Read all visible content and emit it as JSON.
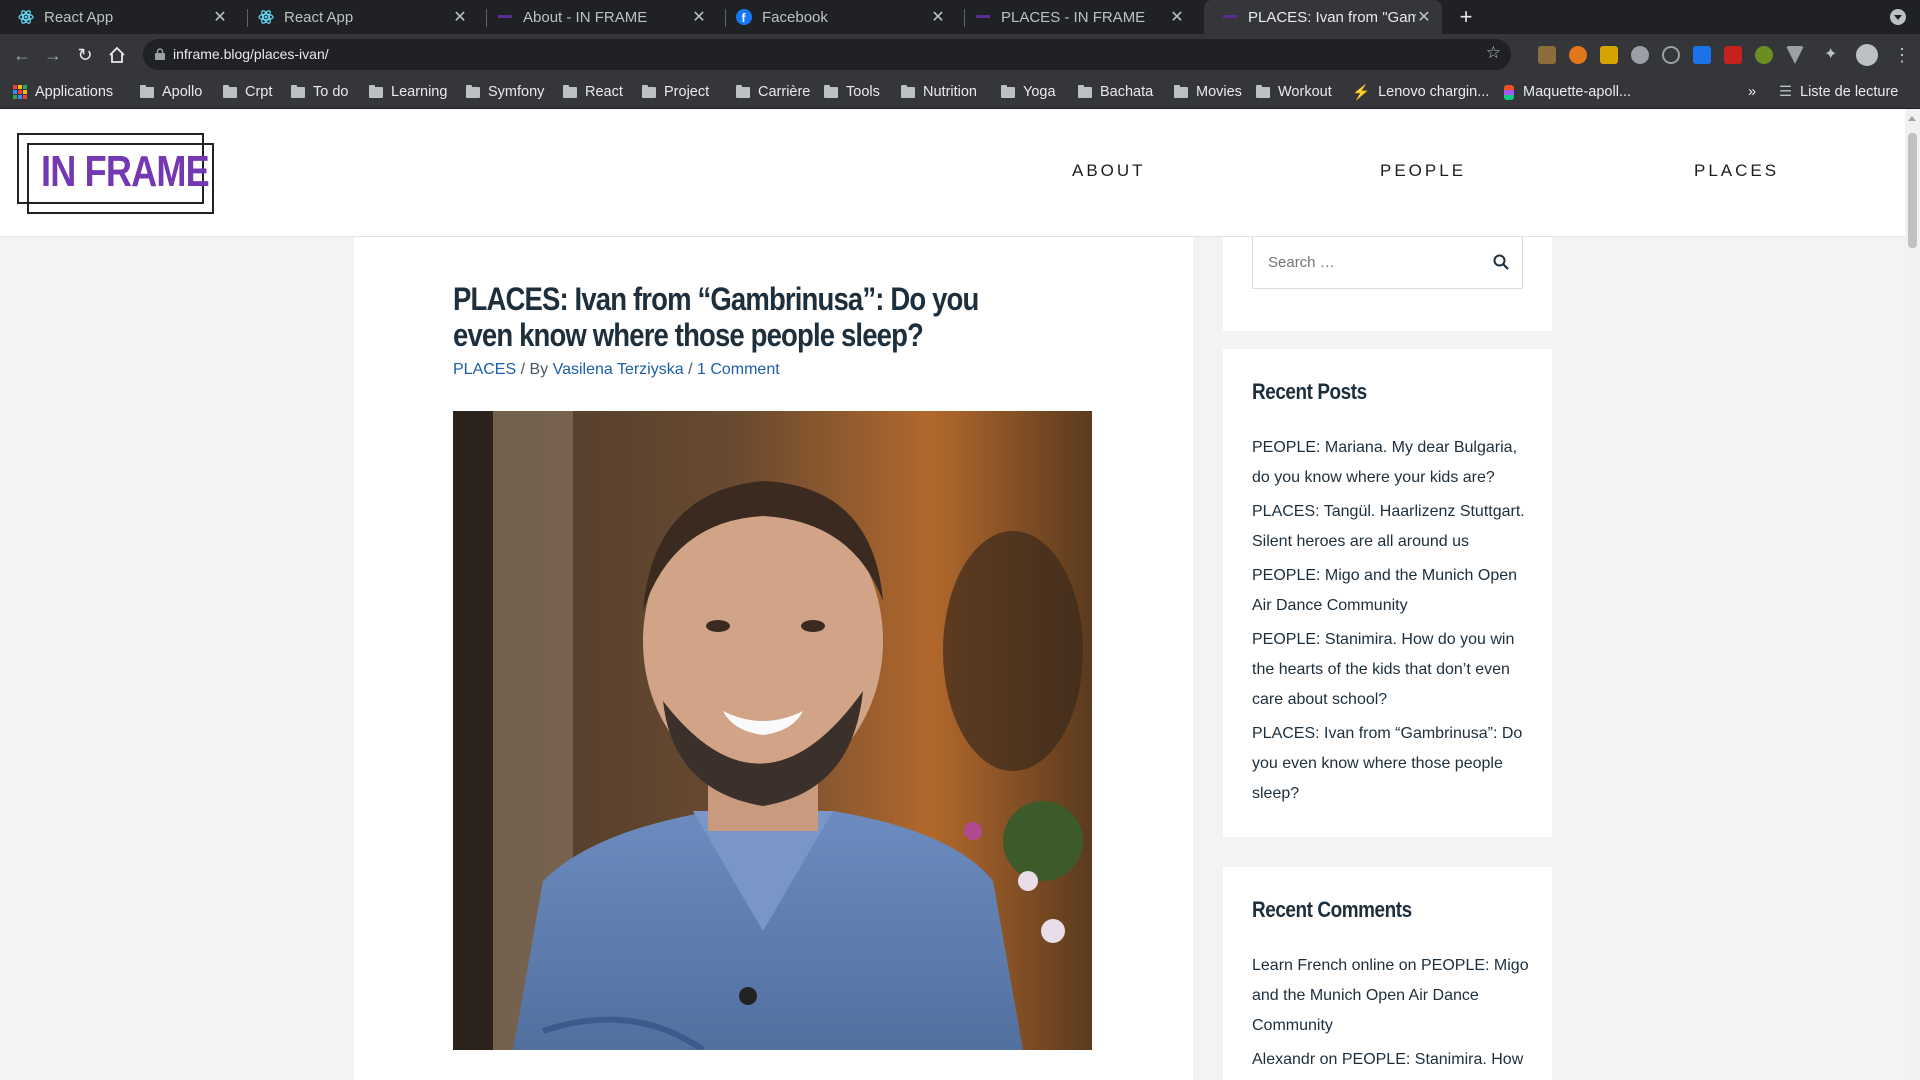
{
  "browser": {
    "tabs": [
      {
        "title": "React App",
        "favicon": "react-icon",
        "active": false
      },
      {
        "title": "React App",
        "favicon": "react-icon",
        "active": false
      },
      {
        "title": "About - IN FRAME",
        "favicon": "inframe-icon",
        "active": false
      },
      {
        "title": "Facebook",
        "favicon": "facebook-icon",
        "active": false
      },
      {
        "title": "PLACES - IN FRAME",
        "favicon": "inframe-icon",
        "active": false
      },
      {
        "title": "PLACES: Ivan from \"Gamb",
        "favicon": "inframe-icon",
        "active": true
      }
    ],
    "url": "inframe.blog/places-ivan/",
    "bookmarks": [
      {
        "label": "Applications",
        "icon": "apps-grid-icon"
      },
      {
        "label": "Apollo",
        "icon": "folder-icon"
      },
      {
        "label": "Crpt",
        "icon": "folder-icon"
      },
      {
        "label": "To do",
        "icon": "folder-icon"
      },
      {
        "label": "Learning",
        "icon": "folder-icon"
      },
      {
        "label": "Symfony",
        "icon": "folder-icon"
      },
      {
        "label": "React",
        "icon": "folder-icon"
      },
      {
        "label": "Project",
        "icon": "folder-icon"
      },
      {
        "label": "Carrière",
        "icon": "folder-icon"
      },
      {
        "label": "Tools",
        "icon": "folder-icon"
      },
      {
        "label": "Nutrition",
        "icon": "folder-icon"
      },
      {
        "label": "Yoga",
        "icon": "folder-icon"
      },
      {
        "label": "Bachata",
        "icon": "folder-icon"
      },
      {
        "label": "Movies",
        "icon": "folder-icon"
      },
      {
        "label": "Workout",
        "icon": "folder-icon"
      },
      {
        "label": "Lenovo chargin...",
        "icon": "lightning-icon"
      },
      {
        "label": "Maquette-apoll...",
        "icon": "figma-icon"
      }
    ],
    "reading_list": "Liste de lecture",
    "more_bookmarks": "»"
  },
  "site": {
    "logo_text": "IN FRAME",
    "brand_color": "#7438b2",
    "nav": [
      "ABOUT",
      "PEOPLE",
      "PLACES"
    ]
  },
  "article": {
    "title": "PLACES: Ivan from “Gambrinusa”: Do you even know where those people sleep?",
    "category": "PLACES",
    "by": " / By ",
    "author": "Vasilena Terziyska",
    "sep": " / ",
    "comments": "1 Comment"
  },
  "sidebar": {
    "search_placeholder": "Search …",
    "recent_posts_title": "Recent Posts",
    "recent_posts": [
      "PEOPLE: Mariana. My dear Bulgaria, do you know where your kids are?",
      "PLACES: Tangül. Haarlizenz Stuttgart. Silent heroes are all around us",
      "PEOPLE: Migo and the Munich Open Air Dance Community",
      "PEOPLE: Stanimira. How do you win the hearts of the kids that don’t even care about school?",
      "PLACES: Ivan from “Gambrinusa”: Do you even know where those people sleep?"
    ],
    "recent_comments_title": "Recent Comments",
    "recent_comments": [
      {
        "author": "Learn French online",
        "on": " on ",
        "post": "PEOPLE: Migo and the Munich Open Air Dance Community"
      },
      {
        "author": "Alexandr",
        "on": " on ",
        "post": "PEOPLE: Stanimira. How"
      }
    ]
  }
}
